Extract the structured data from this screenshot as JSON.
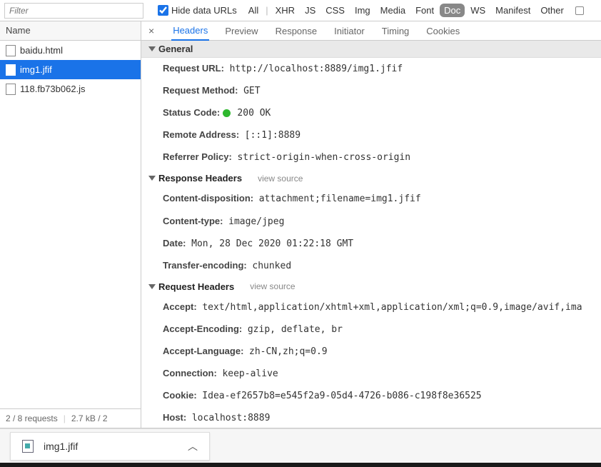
{
  "filter": {
    "placeholder": "Filter"
  },
  "hide_urls_label": "Hide data URLs",
  "type_filters": [
    "All",
    "XHR",
    "JS",
    "CSS",
    "Img",
    "Media",
    "Font",
    "Doc",
    "WS",
    "Manifest",
    "Other"
  ],
  "active_type_filter": "Doc",
  "name_header": "Name",
  "files": [
    {
      "name": "baidu.html",
      "selected": false
    },
    {
      "name": "img1.jfif",
      "selected": true
    },
    {
      "name": "118.fb73b062.js",
      "selected": false
    }
  ],
  "status": {
    "requests": "2 / 8 requests",
    "transfer": "2.7 kB / 2"
  },
  "detail_tabs": [
    "Headers",
    "Preview",
    "Response",
    "Initiator",
    "Timing",
    "Cookies"
  ],
  "active_detail_tab": "Headers",
  "sections": {
    "general": {
      "title": "General",
      "rows": [
        {
          "key": "Request URL:",
          "value": "http://localhost:8889/img1.jfif"
        },
        {
          "key": "Request Method:",
          "value": "GET"
        },
        {
          "key": "Status Code:",
          "value": "200 OK",
          "dot": true
        },
        {
          "key": "Remote Address:",
          "value": "[::1]:8889"
        },
        {
          "key": "Referrer Policy:",
          "value": "strict-origin-when-cross-origin"
        }
      ]
    },
    "response": {
      "title": "Response Headers",
      "view_source": "view source",
      "rows": [
        {
          "key": "Content-disposition:",
          "value": "attachment;filename=img1.jfif"
        },
        {
          "key": "Content-type:",
          "value": "image/jpeg"
        },
        {
          "key": "Date:",
          "value": "Mon, 28 Dec 2020 01:22:18 GMT"
        },
        {
          "key": "Transfer-encoding:",
          "value": "chunked"
        }
      ]
    },
    "request": {
      "title": "Request Headers",
      "view_source": "view source",
      "rows": [
        {
          "key": "Accept:",
          "value": "text/html,application/xhtml+xml,application/xml;q=0.9,image/avif,ima"
        },
        {
          "key": "Accept-Encoding:",
          "value": "gzip, deflate, br"
        },
        {
          "key": "Accept-Language:",
          "value": "zh-CN,zh;q=0.9"
        },
        {
          "key": "Connection:",
          "value": "keep-alive"
        },
        {
          "key": "Cookie:",
          "value": "Idea-ef2657b8=e545f2a9-05d4-4726-b086-c198f8e36525"
        },
        {
          "key": "Host:",
          "value": "localhost:8889"
        }
      ]
    }
  },
  "download": {
    "filename": "img1.jfif"
  }
}
